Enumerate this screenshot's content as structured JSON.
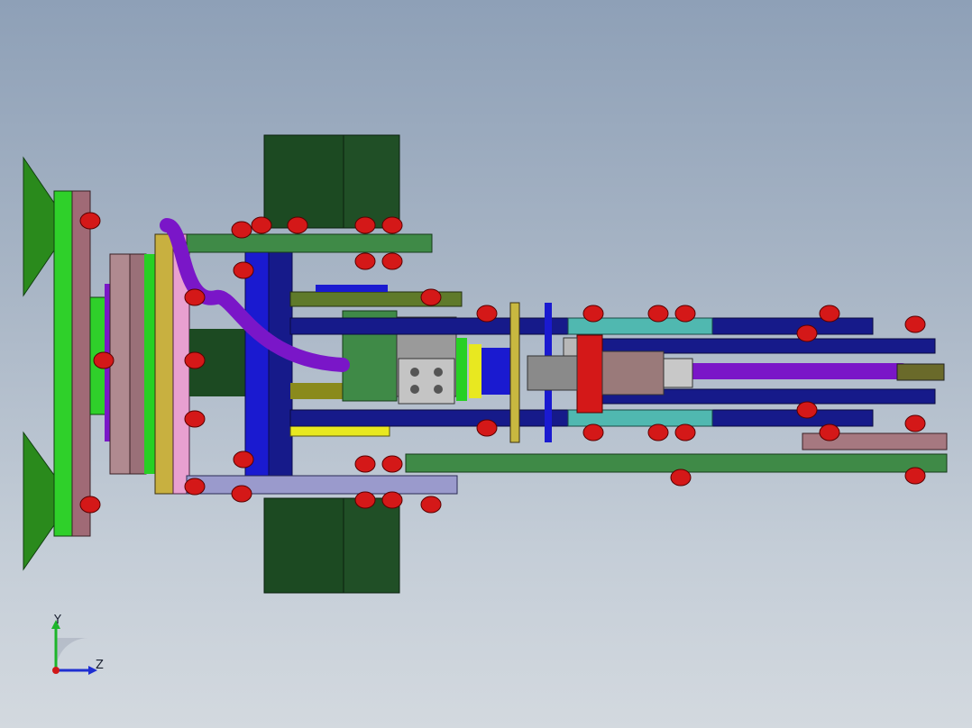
{
  "viewport": {
    "background_top": "#8ea0b7",
    "background_bottom": "#d3d9df"
  },
  "triad": {
    "y_label": "Y",
    "z_label": "Z",
    "y_color": "#1db52a",
    "z_color": "#1f2fd1",
    "x_color": "#d01818"
  },
  "model": {
    "colors": {
      "dark_green": "#1c4a22",
      "bright_green": "#27d024",
      "mid_green": "#3f8a47",
      "navy": "#161a8a",
      "blue": "#1a1ad0",
      "red": "#d41818",
      "purple": "#7a16c8",
      "pink": "#e8a0d0",
      "mauve": "#a67880",
      "olive": "#8a8a1c",
      "yellow": "#e8e820",
      "teal": "#50b8b0",
      "grey": "#8a8a8a",
      "lavender": "#9a9acc"
    }
  }
}
